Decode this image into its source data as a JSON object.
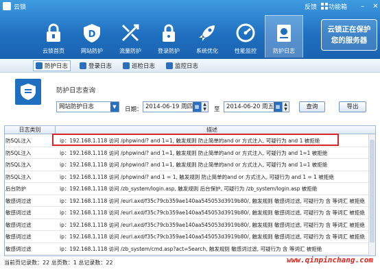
{
  "app": {
    "title": "云锁",
    "feedback": "反馈",
    "function_box": "功能箱",
    "min": "–",
    "close": "✕"
  },
  "nav": [
    {
      "label": "云锁首页",
      "icon": "lock-icon"
    },
    {
      "label": "网站防护",
      "icon": "shield-d-icon"
    },
    {
      "label": "流量防护",
      "icon": "traffic-icon"
    },
    {
      "label": "登录防护",
      "icon": "padlock-icon"
    },
    {
      "label": "系统优化",
      "icon": "rocket-icon"
    },
    {
      "label": "性能监控",
      "icon": "gauge-icon"
    },
    {
      "label": "防护日志",
      "icon": "log-icon"
    }
  ],
  "promo": {
    "line1": "云锁正在保护",
    "line2": "您的服务器"
  },
  "subtabs": [
    "防护日志",
    "登录日志",
    "巡检日志",
    "监控日志"
  ],
  "page": {
    "title": "防护日志查询"
  },
  "filter": {
    "type_value": "网站防护日志",
    "date_label": "日期：",
    "start_date": "2014-06-19 周四",
    "to_label": "至",
    "end_date": "2014-06-20 周五",
    "query": "查询",
    "export": "导出"
  },
  "table": {
    "headers": [
      "日志类别",
      "描述"
    ],
    "rows": [
      {
        "type": "防SQL注入",
        "desc": "ip：192.168.1.118 访问 /phpwind/? and 1=1, 触发规则 防止简单的and or 方式注入, 可疑行为  and 1 被拒绝"
      },
      {
        "type": "防SQL注入",
        "desc": "ip：192.168.1.118 访问 /phpwind/? and 1=1, 触发规则 防止简单的and or 方式注入, 可疑行为  and 1=1 被拒绝"
      },
      {
        "type": "防SQL注入",
        "desc": "ip：192.168.1.118 访问 /phpwind/? and 1=1, 触发规则 防止简单的and or 方式注入, 可疑行为  and 1=1 被拒绝"
      },
      {
        "type": "防SQL注入",
        "desc": "ip：192.168.1.118 访问 /phpwind/?  and  1 = 1, 触发规则 防止简单的and or 方式注入, 可疑行为   and  1 = 1 被拒绝"
      },
      {
        "type": "后台防护",
        "desc": "ip：192.168.1.118 访问 /zb_system/login.asp, 触发规则 后台保护, 可疑行为 /zb_system/login.asp 被拒绝"
      },
      {
        "type": "敏感词过滤",
        "desc": "ip：192.168.1.118 访问 /eurl.axd/f35c79cb359ae140aa545053d3919b80/, 触发规则 敏感词过滤, 可疑行为 含  等词汇 被拒绝"
      },
      {
        "type": "敏感词过滤",
        "desc": "ip：192.168.1.118 访问 /eurl.axd/f35c79cb359ae140aa545053d3919b80/, 触发规则 敏感词过滤, 可疑行为 含  等词汇 被拒绝"
      },
      {
        "type": "敏感词过滤",
        "desc": "ip：192.168.1.118 访问 /eurl.axd/f35c79cb359ae140aa545053d3919b80/, 触发规则 敏感词过滤, 可疑行为 含  等词汇 被拒绝"
      },
      {
        "type": "敏感词过滤",
        "desc": "ip：192.168.1.118 访问 /eurl.axd/f35c79cb359ae140aa545053d3919b80/, 触发规则 敏感词过滤, 可疑行为 含  等词汇 被拒绝"
      },
      {
        "type": "敏感词过滤",
        "desc": "ip：192.168.1.118 访问 /zb_system/cmd.asp?act=Search, 触发规则 敏感词过滤, 可疑行为 含  等词汇 被拒绝"
      },
      {
        "type": "敏感词过滤",
        "desc": "ip：192.168.1.118 访问 /zb_system/cmd.asp?act=Search, 触发规则 敏感词过滤, 可疑行为 含  等词汇 被拒绝"
      }
    ]
  },
  "status": {
    "text": "当前页记录数：22    总页数：1    总记录数：22"
  },
  "watermark": "www.qinpinchang.com"
}
